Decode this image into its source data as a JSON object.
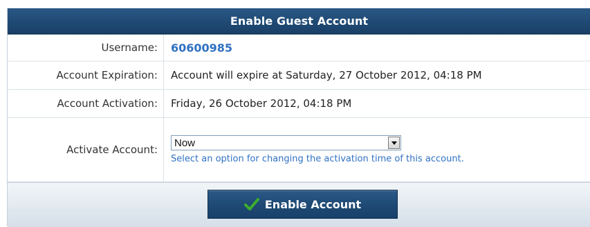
{
  "panel": {
    "title": "Enable Guest Account"
  },
  "fields": {
    "username": {
      "label": "Username:",
      "value": "60600985"
    },
    "expiration": {
      "label": "Account Expiration:",
      "value": "Account will expire at Saturday, 27 October 2012, 04:18 PM"
    },
    "activation": {
      "label": "Account Activation:",
      "value": "Friday, 26 October 2012, 04:18 PM"
    },
    "activate": {
      "label": "Activate Account:",
      "selected": "Now",
      "hint": "Select an option for changing the activation time of this account."
    }
  },
  "actions": {
    "enable_label": "Enable Account"
  },
  "icons": {
    "enable": "checkmark-icon",
    "dropdown": "chevron-down-icon"
  },
  "colors": {
    "header": "#1f4a74",
    "link": "#2f71c2",
    "check": "#3cae2b"
  }
}
